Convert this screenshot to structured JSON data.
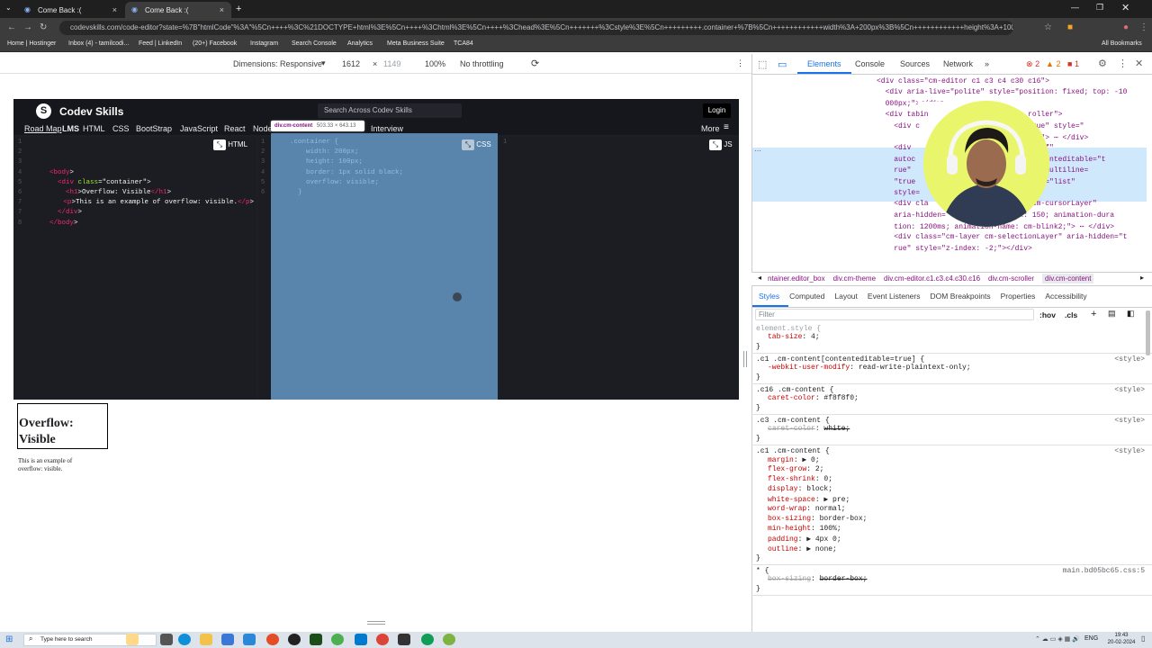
{
  "browser": {
    "tabs": [
      {
        "label": "Come Back :(",
        "active": false
      },
      {
        "label": "Come Back :(",
        "active": true
      }
    ],
    "url": "codevskills.com/code-editor?state=%7B\"htmlCode\"%3A\"%5Cn++++%3C%21DOCTYPE+html%3E%5Cn++++%3Chtml%3E%5Cn++++%3Chead%3E%5Cn+++++++%3Cstyle%3E%5Cn+++++++++.container+%7B%5Cn++++++++++++width%3A+200px%3B%5Cn++++++++++++height%3A+100px%3B%5Cn++++++++++++border%3A+1px+solid+black%3B%5Cn...",
    "bookmarks": [
      "Home | Hostinger",
      "Inbox (4) - tamilcodi...",
      "Feed | LinkedIn",
      "(20+) Facebook",
      "Instagram",
      "Search Console",
      "Analytics",
      "Meta Business Suite",
      "TCA84"
    ],
    "all_bookmarks": "All Bookmarks"
  },
  "device_toolbar": {
    "dimensions": "Dimensions: Responsive",
    "width": "1612",
    "times": "×",
    "height": "1149",
    "zoom": "100%",
    "throttling": "No throttling"
  },
  "site": {
    "brand": "Codev Skills",
    "search_placeholder": "Search Across Codev Skills",
    "login": "Login",
    "nav": [
      "Road Map",
      "LMS",
      "HTML",
      "CSS",
      "BootStrap",
      "JavaScript",
      "React",
      "Node",
      "Interview"
    ],
    "more": "More",
    "html_label": "HTML",
    "css_label": "CSS",
    "js_label": "JS",
    "html_code": [
      {
        "n": "1",
        "t": ""
      },
      {
        "n": "2",
        "t": ""
      },
      {
        "n": "3",
        "t": ""
      },
      {
        "n": "4",
        "t": "  <body>"
      },
      {
        "n": "5",
        "t": "    <div class=\"container\">"
      },
      {
        "n": "6",
        "t": "      <h1>Overflow: Visible</h1>"
      },
      {
        "n": "7",
        "t": "      <p>This is an example of overflow: visible.</p>"
      },
      {
        "n": "7",
        "t": "    </div>"
      },
      {
        "n": "8",
        "t": "  </body>"
      }
    ],
    "css_code": [
      {
        "n": "1",
        "t": ".container {"
      },
      {
        "n": "2",
        "t": "    width: 200px;"
      },
      {
        "n": "3",
        "t": "    height: 100px;"
      },
      {
        "n": "4",
        "t": "    border: 1px solid black;"
      },
      {
        "n": "5",
        "t": "    overflow: visible;"
      },
      {
        "n": "6",
        "t": "  }"
      }
    ],
    "js_line": "1"
  },
  "inspect_tooltip": {
    "tag": "div.cm-content",
    "size": "503.33 × 643.13"
  },
  "preview": {
    "heading_line1": "Overflow:",
    "heading_line2": "Visible",
    "paragraph_line1": "This is an example of",
    "paragraph_line2": "overflow: visible."
  },
  "devtools": {
    "tabs": [
      "Elements",
      "Console",
      "Sources",
      "Network",
      "»"
    ],
    "errors": "2",
    "warnings": "2",
    "issues": "1",
    "dom_lines": [
      "<div class=\"cm-editor ͼ1 ͼ3 ͼ4 ͼ30 ͼ16\">",
      "  <div aria-live=\"polite\" style=\"position: fixed; top: -10",
      "  000px;\"></div>",
      "  <div tabin                       roller\">",
      "    <div c                    den=\"true\" style=\"",
      "                                      \"> ⋯ </div>",
      "    <div                          t=\"off\"",
      "    autoc                          contenteditable=\"t",
      "    rue\"                     box\" aria-multiline=",
      "    \"true                  autocomplete=\"list\"",
      "    style=                          $0",
      "    <div cla                  above cm-cursorLayer\"",
      "    aria-hidden=            -index: 150; animation-dura",
      "    tion: 1200ms; animation-name: cm-blink2;\"> ⋯ </div>",
      "    <div class=\"cm-layer cm-selectionLayer\" aria-hidden=\"t",
      "    rue\" style=\"z-index: -2;\"></div>"
    ],
    "breadcrumbs": [
      "ntainer.editor_box",
      "div.cm-theme",
      "div.cm-editor.ͼ1.ͼ3.ͼ4.ͼ30.ͼ16",
      "div.cm-scroller",
      "div.cm-content"
    ],
    "subtabs": [
      "Styles",
      "Computed",
      "Layout",
      "Event Listeners",
      "DOM Breakpoints",
      "Properties",
      "Accessibility"
    ],
    "filter_placeholder": "Filter",
    "hov": ":hov",
    "cls": ".cls",
    "rules": [
      {
        "sel": "element.style {",
        "src": "",
        "props": [
          [
            "tab-size",
            "4;"
          ]
        ]
      },
      {
        "sel": ".ͼ1 .cm-content[contenteditable=true] {",
        "src": "<style>",
        "props": [
          [
            "-webkit-user-modify",
            "read-write-plaintext-only;"
          ]
        ]
      },
      {
        "sel": ".ͼ16 .cm-content {",
        "src": "<style>",
        "props": [
          [
            "caret-color",
            "#f8f8f0;"
          ]
        ]
      },
      {
        "sel": ".ͼ3 .cm-content {",
        "src": "<style>",
        "props": [
          [
            "caret-color",
            "white;"
          ]
        ]
      },
      {
        "sel": ".ͼ1 .cm-content {",
        "src": "<style>",
        "props": [
          [
            "margin",
            "▶ 0;"
          ],
          [
            "flex-grow",
            "2;"
          ],
          [
            "flex-shrink",
            "0;"
          ],
          [
            "display",
            "block;"
          ],
          [
            "white-space",
            "▶ pre;"
          ],
          [
            "word-wrap",
            "normal;"
          ],
          [
            "box-sizing",
            "border-box;"
          ],
          [
            "min-height",
            "100%;"
          ],
          [
            "padding",
            "▶ 4px 0;"
          ],
          [
            "outline",
            "▶ none;"
          ]
        ]
      },
      {
        "sel": "* {",
        "src": "main.bd05bc65.css:5",
        "props": [
          [
            "box-sizing",
            "border-box;"
          ]
        ]
      }
    ]
  },
  "taskbar": {
    "search_placeholder": "Type here to search",
    "lang": "ENG",
    "time": "19:43",
    "date": "20-02-2024"
  }
}
